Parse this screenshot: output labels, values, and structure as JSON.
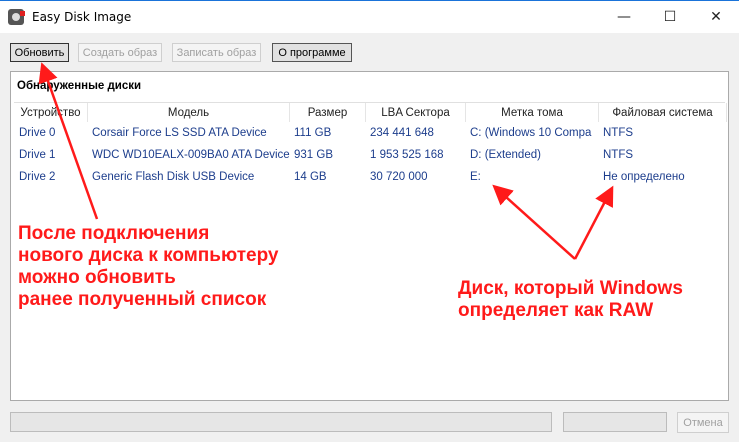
{
  "window": {
    "title": "Easy Disk Image",
    "minimize": "—",
    "maximize": "☐",
    "close": "✕"
  },
  "toolbar": {
    "refresh": "Обновить",
    "create_image": "Создать образ",
    "write_image": "Записать образ",
    "about": "О программе"
  },
  "group": {
    "title": "Обнаруженные диски"
  },
  "columns": [
    "Устройство",
    "Модель",
    "Размер",
    "LBA Сектора",
    "Метка тома",
    "Файловая система"
  ],
  "rows": [
    [
      "Drive 0",
      "Corsair Force LS SSD ATA Device",
      "111 GB",
      "234 441 648",
      "C: (Windows 10 Compa",
      "NTFS"
    ],
    [
      "Drive 1",
      "WDC WD10EALX-009BA0 ATA Device",
      "931 GB",
      "1 953 525 168",
      "D: (Extended)",
      "NTFS"
    ],
    [
      "Drive 2",
      "Generic Flash Disk USB Device",
      "14 GB",
      "30 720 000",
      "E:",
      "Не определено"
    ]
  ],
  "annotations": {
    "left": [
      "После подключения",
      "нового диска к компьютеру",
      "можно обновить",
      "ранее полученный список"
    ],
    "right": [
      "Диск, который Windows",
      "определяет как RAW"
    ],
    "color": "#ff1a1a"
  },
  "footer": {
    "cancel": "Отмена",
    "progress": 0
  }
}
